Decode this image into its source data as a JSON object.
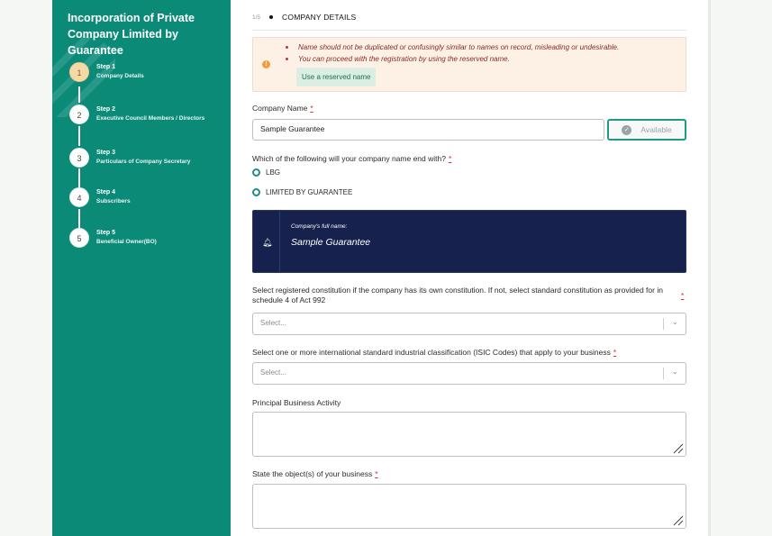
{
  "sidebar": {
    "title": "Incorporation of Private Company Limited by Guarantee",
    "steps": [
      {
        "num": "1",
        "label": "Step 1",
        "desc": "Company Details",
        "active": true
      },
      {
        "num": "2",
        "label": "Step 2",
        "desc": "Executive Council Members / Directors",
        "active": false
      },
      {
        "num": "3",
        "label": "Step 3",
        "desc": "Particulars of Company Secretary",
        "active": false
      },
      {
        "num": "4",
        "label": "Step 4",
        "desc": "Subscribers",
        "active": false
      },
      {
        "num": "5",
        "label": "Step 5",
        "desc": "Beneficial Owner(BO)",
        "active": false
      }
    ]
  },
  "header": {
    "count": "1/5",
    "title": "COMPANY DETAILS"
  },
  "alert": {
    "items": [
      "Name should not be duplicated or confusingly similar to names on record, misleading or undesirable.",
      "You can proceed with the registration by using the reserved name."
    ],
    "button": "Use a reserved name"
  },
  "company_name": {
    "label": "Company Name",
    "required": "*",
    "value": "Sample Guarantee",
    "status_button": "Available"
  },
  "ending": {
    "question": "Which of the following will your company name end with?",
    "required": "*",
    "options": [
      "LBG",
      "LIMITED BY GUARANTEE"
    ]
  },
  "full_name_box": {
    "caption": "Company's full name:",
    "value": "Sample Guarantee"
  },
  "constitution": {
    "label": "Select registered constitution if the company has its own constitution. If not, select standard constitution as provided for in schedule 4 of Act 992",
    "required": "*",
    "placeholder": "Select..."
  },
  "isic": {
    "label": "Select one or more international standard industrial classification (ISIC Codes) that apply to your business",
    "required": "*",
    "placeholder": "Select..."
  },
  "principal_activity": {
    "label": "Principal Business Activity"
  },
  "objects": {
    "label": "State the object(s) of your business",
    "required": "*"
  },
  "colors": {
    "sidebar": "#0b8a78",
    "active_step": "#f6d9a8",
    "name_box": "#17214e",
    "accent": "#1f9a86",
    "required": "#e02b2b"
  },
  "icons": [
    "exclamation-icon",
    "check-circle-icon",
    "bell-icon",
    "chevron-down-icon",
    "resize-grip-icon"
  ]
}
